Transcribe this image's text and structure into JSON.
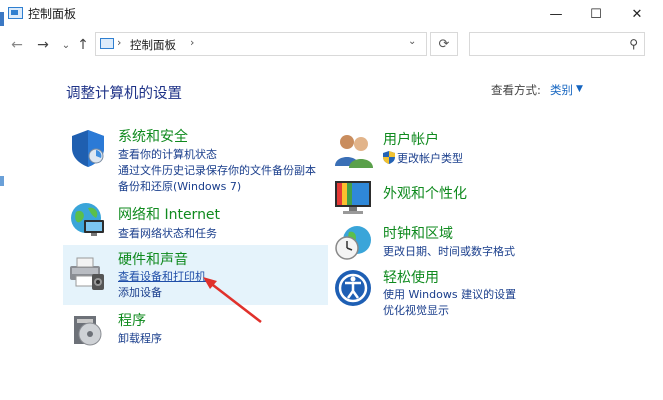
{
  "window": {
    "title": "控制面板",
    "minimize": "—",
    "maximize": "☐",
    "close": "✕"
  },
  "nav": {
    "back": "←",
    "forward": "→",
    "recent": "⌄",
    "up": "↑",
    "breadcrumb": "控制面板",
    "sep": "›",
    "refresh": "⟳",
    "search_placeholder": ""
  },
  "header": {
    "title": "调整计算机的设置",
    "view_by_label": "查看方式:",
    "view_by_value": "类别"
  },
  "categories": [
    {
      "title": "系统和安全",
      "links": [
        "查看你的计算机状态",
        "通过文件历史记录保存你的文件备份副本",
        "备份和还原(Windows 7)"
      ]
    },
    {
      "title": "网络和 Internet",
      "links": [
        "查看网络状态和任务"
      ]
    },
    {
      "title": "硬件和声音",
      "links": [
        "查看设备和打印机",
        "添加设备"
      ]
    },
    {
      "title": "程序",
      "links": [
        "卸载程序"
      ]
    },
    {
      "title": "用户帐户",
      "links": [
        "更改帐户类型"
      ]
    },
    {
      "title": "外观和个性化",
      "links": []
    },
    {
      "title": "时钟和区域",
      "links": [
        "更改日期、时间或数字格式"
      ]
    },
    {
      "title": "轻松使用",
      "links": [
        "使用 Windows 建议的设置",
        "优化视觉显示"
      ]
    }
  ],
  "colors": {
    "accent": "#1565c0",
    "category_title": "#0f8a1e",
    "heading": "#1e3287",
    "highlight": "#e5f3fb",
    "arrow": "#e0312b"
  }
}
